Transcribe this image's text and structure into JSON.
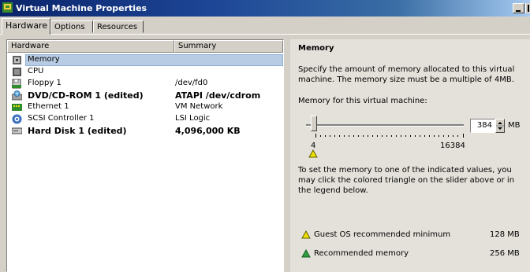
{
  "window": {
    "title": "Virtual Machine Properties"
  },
  "tabs": [
    {
      "label": "Hardware"
    },
    {
      "label": "Options"
    },
    {
      "label": "Resources"
    }
  ],
  "list": {
    "columns": {
      "hardware": "Hardware",
      "summary": "Summary"
    },
    "rows": [
      {
        "name": "Memory",
        "summary": "",
        "icon": "memory-icon",
        "bold": false,
        "selected": true
      },
      {
        "name": "CPU",
        "summary": "",
        "icon": "cpu-icon",
        "bold": false,
        "selected": false
      },
      {
        "name": "Floppy 1",
        "summary": "/dev/fd0",
        "icon": "floppy-icon",
        "bold": false,
        "selected": false
      },
      {
        "name": "DVD/CD-ROM 1 (edited)",
        "summary": "ATAPI /dev/cdrom",
        "icon": "cdrom-icon",
        "bold": true,
        "selected": false
      },
      {
        "name": "Ethernet 1",
        "summary": "VM Network",
        "icon": "network-icon",
        "bold": false,
        "selected": false
      },
      {
        "name": "SCSI Controller 1",
        "summary": "LSI Logic",
        "icon": "scsi-icon",
        "bold": false,
        "selected": false
      },
      {
        "name": "Hard Disk 1 (edited)",
        "summary": "4,096,000 KB",
        "icon": "harddisk-icon",
        "bold": true,
        "selected": false
      }
    ]
  },
  "memory": {
    "title": "Memory",
    "description": "Specify the amount of memory allocated to this virtual machine. The memory size must be a multiple of 4MB.",
    "prompt": "Memory for this virtual machine:",
    "value": "384",
    "unit": "MB",
    "min_label": "4",
    "max_label": "16384",
    "hint": "To set the memory to one of the indicated values, you may click the colored triangle on the slider above or in the legend below.",
    "legend": [
      {
        "label": "Guest OS recommended minimum",
        "value": "128 MB",
        "color": "#f0e000"
      },
      {
        "label": "Recommended memory",
        "value": "256 MB",
        "color": "#2ea043"
      }
    ]
  }
}
